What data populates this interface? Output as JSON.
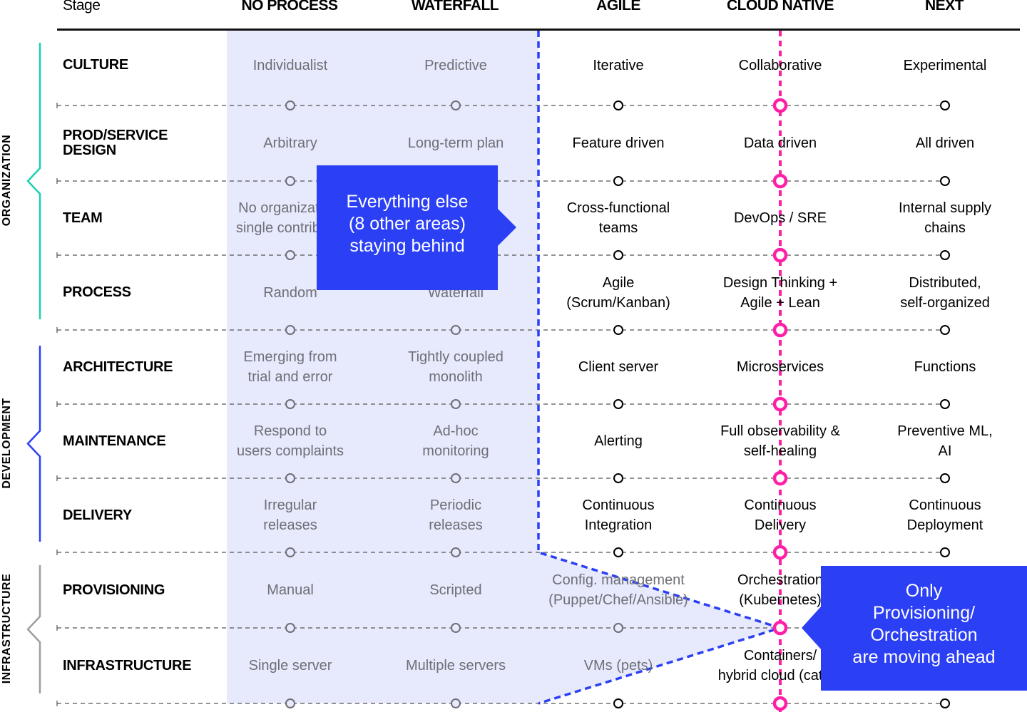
{
  "header": {
    "stage_label": "Stage",
    "columns": [
      "NO PROCESS",
      "WATERFALL",
      "AGILE",
      "CLOUD NATIVE",
      "NEXT"
    ]
  },
  "groups": [
    {
      "label": "ORGANIZATION",
      "color": "#1ecfb0",
      "rows": [
        0,
        1,
        2,
        3
      ]
    },
    {
      "label": "DEVELOPMENT",
      "color": "#2b3ff5",
      "rows": [
        4,
        5,
        6
      ]
    },
    {
      "label": "INFRASTRUCTURE",
      "color": "#9e9e9e",
      "rows": [
        7,
        8
      ]
    }
  ],
  "rows": [
    {
      "label": "CULTURE",
      "cells": [
        "Individualist",
        "Predictive",
        "Iterative",
        "Collaborative",
        "Experimental"
      ]
    },
    {
      "label": "PROD/SERVICE\nDESIGN",
      "cells": [
        "Arbitrary",
        "Long-term plan",
        "Feature driven",
        "Data driven",
        "All driven"
      ]
    },
    {
      "label": "TEAM",
      "cells": [
        "No organization,\nsingle contributor",
        "",
        "Cross-functional\nteams",
        "DevOps / SRE",
        "Internal supply\nchains"
      ]
    },
    {
      "label": "PROCESS",
      "cells": [
        "Random",
        "Waterfall",
        "Agile\n(Scrum/Kanban)",
        "Design Thinking +\nAgile + Lean",
        "Distributed,\nself-organized"
      ]
    },
    {
      "label": "ARCHITECTURE",
      "cells": [
        "Emerging from\ntrial and error",
        "Tightly coupled\nmonolith",
        "Client server",
        "Microservices",
        "Functions"
      ]
    },
    {
      "label": "MAINTENANCE",
      "cells": [
        "Respond to\nusers complaints",
        "Ad-hoc\nmonitoring",
        "Alerting",
        "Full observability &\nself-healing",
        "Preventive ML,\nAI"
      ]
    },
    {
      "label": "DELIVERY",
      "cells": [
        "Irregular\nreleases",
        "Periodic\nreleases",
        "Continuous\nIntegration",
        "Continuous\nDelivery",
        "Continuous\nDeployment"
      ]
    },
    {
      "label": "PROVISIONING",
      "cells": [
        "Manual",
        "Scripted",
        "Config. management\n(Puppet/Chef/Ansible)",
        "Orchestration\n(Kubernetes)",
        ""
      ]
    },
    {
      "label": "INFRASTRUCTURE",
      "cells": [
        "Single server",
        "Multiple servers",
        "VMs (pets)",
        "Containers/\nhybrid cloud (cattle)",
        ""
      ]
    }
  ],
  "callouts": {
    "behind": "Everything else\n(8 other areas)\nstaying behind",
    "ahead": "Only\nProvisioning/\nOrchestration\nare moving ahead"
  },
  "colors": {
    "accent_blue": "#2b3ff5",
    "highlight_pink": "#ff1fa6",
    "shade": "#e7e9fd",
    "grey_text": "#6e6f76"
  }
}
